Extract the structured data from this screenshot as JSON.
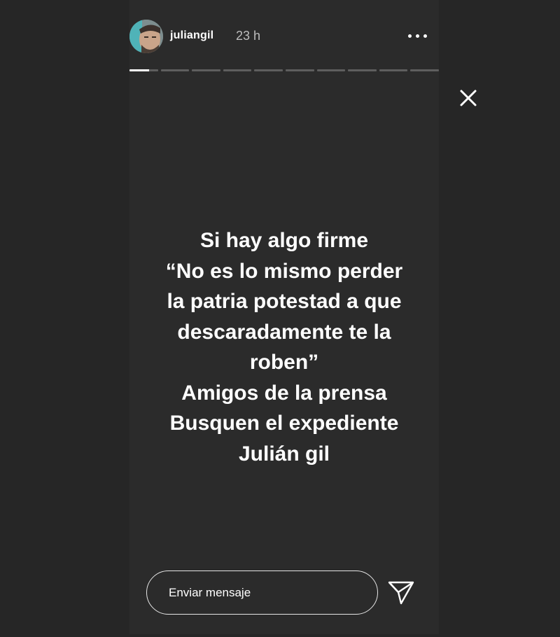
{
  "header": {
    "username": "juliangil",
    "time_ago": "23 h",
    "avatar_icon": "user-avatar",
    "more_icon": "more-horizontal-icon"
  },
  "progress": {
    "segments": 10,
    "current_segment": 1,
    "current_fraction": 0.7
  },
  "close_icon": "close-icon",
  "story": {
    "text_lines": [
      "Si hay algo firme",
      "“No es lo mismo perder",
      "la patria potestad a que",
      "descaradamente te la",
      "roben”",
      "Amigos de la prensa",
      "Busquen el expediente",
      "Julián gil"
    ]
  },
  "reply": {
    "placeholder": "Enviar mensaje",
    "send_icon": "send-icon"
  },
  "colors": {
    "page_background": "#262626",
    "story_background": "#2b2b2b",
    "text": "#ffffff",
    "progress_track": "#5e5e5e",
    "progress_fill": "#ffffff"
  }
}
